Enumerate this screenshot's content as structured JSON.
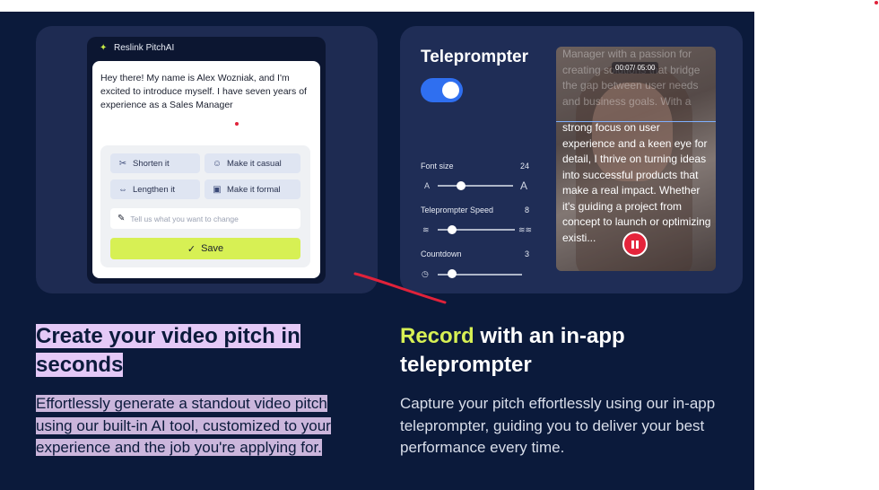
{
  "pitch": {
    "app_title": "Reslink PitchAI",
    "message": "Hey there! My name is Alex Wozniak, and I'm excited to introduce myself. I have seven years of experience as a Sales Manager",
    "chips": {
      "shorten": "Shorten it",
      "casual": "Make it casual",
      "lengthen": "Lengthen it",
      "formal": "Make it formal"
    },
    "input_placeholder": "Tell us what you want to change",
    "save_label": "Save"
  },
  "teleprompter": {
    "title": "Teleprompter",
    "toggle_on": true,
    "font_size_label": "Font size",
    "font_size_value": "24",
    "font_small_glyph": "A",
    "font_large_glyph": "A",
    "speed_label": "Teleprompter Speed",
    "speed_value": "8",
    "countdown_label": "Countdown",
    "countdown_value": "3",
    "timer": "00:07/ 05:00",
    "faded_script": "Manager with a passion for creating solutions that bridge the gap between user needs and business goals. With a",
    "script": "strong focus on user experience and a keen eye for detail, I thrive on turning ideas into successful products that make a real impact. Whether it's guiding a project from concept to launch or optimizing existi..."
  },
  "left_section": {
    "heading": "Create your video pitch in seconds",
    "body": "Effortlessly generate a standout video pitch using our built-in AI tool, customized to your experience and the job you're applying for."
  },
  "right_section": {
    "heading_accent": "Record",
    "heading_rest": " with an in-app teleprompter",
    "body": "Capture your pitch effortlessly using our in-app teleprompter, guiding you to deliver your best performance every time."
  },
  "colors": {
    "background": "#0b1a3b",
    "accent_green": "#d7f054",
    "toggle_blue": "#2f6ff0",
    "record_red": "#e5243b",
    "highlight_purple": "#e4c9f7"
  }
}
